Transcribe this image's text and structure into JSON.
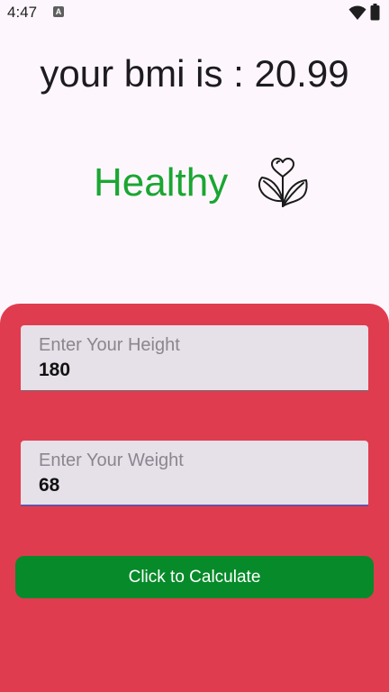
{
  "status_bar": {
    "time": "4:47",
    "notification_glyph": "A",
    "icons": [
      "wifi-icon",
      "battery-icon"
    ]
  },
  "result": {
    "bmi_text": "your bmi is : 20.99",
    "category": "Healthy",
    "category_color": "#1aa632",
    "category_icon": "heart-plant-icon"
  },
  "form": {
    "height": {
      "label": "Enter Your Height",
      "value": "180"
    },
    "weight": {
      "label": "Enter Your Weight",
      "value": "68"
    },
    "submit_label": "Click to Calculate"
  },
  "colors": {
    "panel_background": "#e03c4f",
    "button_background": "#078a2a",
    "field_background": "#e6e0e8",
    "focus_underline": "#6750a4"
  }
}
